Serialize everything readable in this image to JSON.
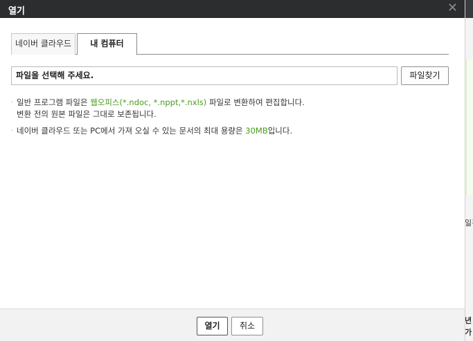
{
  "dialog": {
    "title": "열기",
    "close_glyph": "✕"
  },
  "tabs": [
    {
      "label": "네이버 클라우드",
      "active": false
    },
    {
      "label": "내 컴퓨터",
      "active": true
    }
  ],
  "file": {
    "value": "파일을 선택해 주세요.",
    "find_button": "파일찾기"
  },
  "notes": {
    "note1_pre": "일반 프로그램 파일은 ",
    "note1_green": "웹오피스(*.ndoc, *.nppt,*.nxls)",
    "note1_post": " 파일로 변환하여 편집합니다.",
    "note1_line2": "변환 전의 원본 파일은 그대로 보존됩니다.",
    "note2_pre": "네이버 클라우드 또는 PC에서 가져 오실 수 있는 문서의 최대 용량은 ",
    "note2_green": "30MB",
    "note2_post": "입니다.",
    "bullet": "·"
  },
  "footer": {
    "open_button": "열기",
    "cancel_button": "취소"
  },
  "background": {
    "text1": "일김",
    "text2": "년",
    "text3": "가"
  },
  "colors": {
    "titlebar": "#2b2d2f",
    "accent_green": "#4b9b1e"
  }
}
